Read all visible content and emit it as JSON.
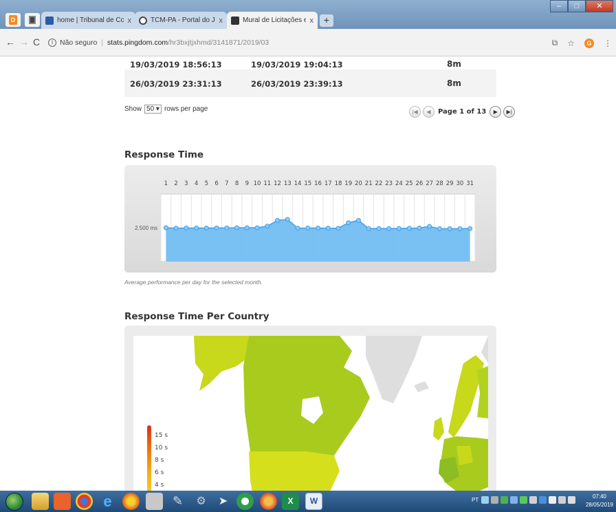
{
  "browser": {
    "tabs": [
      {
        "title": "home | Tribunal de Contas dos M",
        "close": "x",
        "active": false
      },
      {
        "title": "TCM-PA - Portal do Jurisdicionad",
        "close": "x",
        "active": false
      },
      {
        "title": "Mural de Licitações e Contratos",
        "close": "x",
        "active": true
      }
    ],
    "new_tab": "+",
    "security_label": "Não seguro",
    "url_host": "stats.pingdom.com",
    "url_path": "/hr3bxjtjxhmd/3141871/2019/03"
  },
  "table": {
    "rows": [
      {
        "start": "19/03/2019 18:56:13",
        "end": "19/03/2019 19:04:13",
        "duration": "8m"
      },
      {
        "start": "26/03/2019 23:31:13",
        "end": "26/03/2019 23:39:13",
        "duration": "8m"
      }
    ],
    "show_label": "Show",
    "rows_per_page_value": "50",
    "rows_per_page_suffix": "rows per page",
    "page_label": "Page 1 of 13"
  },
  "response_time": {
    "title": "Response Time",
    "caption": "Average performance per day for the selected month."
  },
  "chart_data": {
    "type": "area",
    "title": "Response Time",
    "x": [
      1,
      2,
      3,
      4,
      5,
      6,
      7,
      8,
      9,
      10,
      11,
      12,
      13,
      14,
      15,
      16,
      17,
      18,
      19,
      20,
      21,
      22,
      23,
      24,
      25,
      26,
      27,
      28,
      29,
      30,
      31
    ],
    "y_tick_label": "2.500 ms",
    "ylim": [
      0,
      5000
    ],
    "values": [
      2500,
      2470,
      2480,
      2480,
      2480,
      2490,
      2490,
      2500,
      2500,
      2500,
      2620,
      3050,
      3120,
      2470,
      2480,
      2480,
      2470,
      2460,
      2870,
      3050,
      2440,
      2440,
      2440,
      2450,
      2460,
      2480,
      2600,
      2430,
      2430,
      2430,
      2440
    ],
    "series_color": "#6cbaf2",
    "grid": true
  },
  "per_country": {
    "title": "Response Time Per Country",
    "legend": [
      "15 s",
      "10 s",
      "8 s",
      "6 s",
      "4 s"
    ]
  },
  "taskbar": {
    "lang": "PT",
    "time": "07:40",
    "date": "28/05/2019"
  }
}
